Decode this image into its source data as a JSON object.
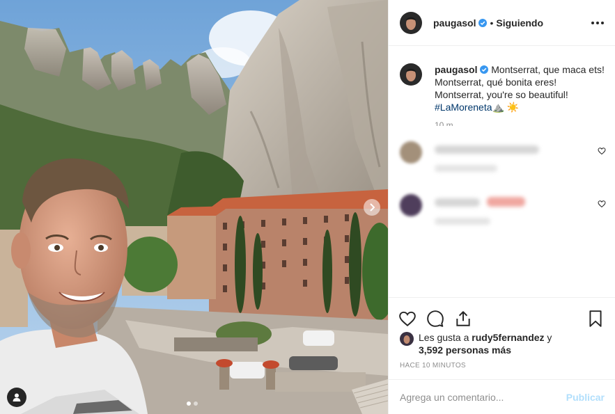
{
  "post": {
    "username": "paugasol",
    "follow_status": "Siguiendo",
    "separator": "•",
    "caption_lines": [
      "Montserrat, que maca ets!",
      "Montserrat, qué bonita eres!",
      "Montserrat, you're so beautiful!"
    ],
    "hashtag": "#LaMoreneta",
    "caption_emojis": "⛰️ ☀️",
    "caption_time": "10 m"
  },
  "likes": {
    "prefix": "Les gusta a",
    "liker": "rudy5fernandez",
    "joiner": "y",
    "count_text": "3,592 personas más"
  },
  "timeago": "HACE 10 MINUTOS",
  "comment_input": {
    "placeholder": "Agrega un comentario...",
    "submit_label": "Publicar"
  },
  "carousel": {
    "slides": 2,
    "active_slide": 1
  },
  "icons": {
    "verified": "verified-badge-icon",
    "more": "more-options-icon",
    "like": "heart-icon",
    "comment": "comment-icon",
    "share": "share-icon",
    "save": "bookmark-icon",
    "tag": "user-tag-icon",
    "next": "chevron-right-icon"
  },
  "colors": {
    "verified_blue": "#3897f0",
    "hashtag": "#00376b",
    "post_button_disabled": "#b2dffc",
    "muted_text": "#8e8e8e",
    "border": "#efefef"
  }
}
